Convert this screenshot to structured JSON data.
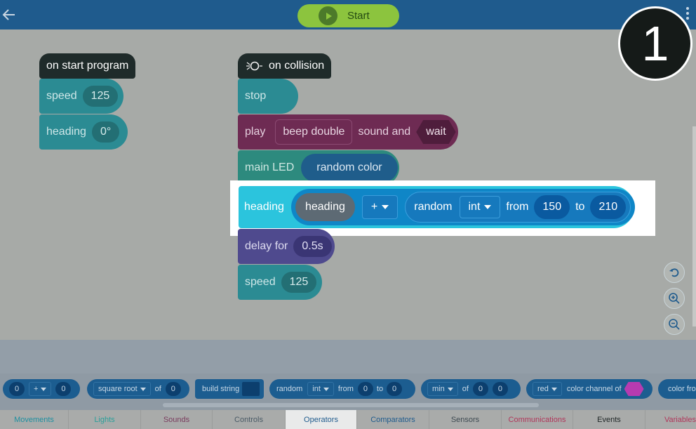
{
  "toolbar": {
    "start_label": "Start"
  },
  "step_badge": "1",
  "blocks": {
    "start_hat": "on start program",
    "speed_label": "speed",
    "speed_value": "125",
    "heading_label": "heading",
    "heading_value": "0°",
    "collision_hat": "on collision",
    "stop": "stop",
    "play": "play",
    "sound_name": "beep double",
    "sound_and": "sound and",
    "wait": "wait",
    "main_led": "main LED",
    "random_color": "random color",
    "heading2": "heading",
    "heading_var": "heading",
    "operator": "+",
    "random": "random",
    "int": "int",
    "from": "from",
    "from_value": "150",
    "to": "to",
    "to_value": "210",
    "delay_for": "delay for",
    "delay_value": "0.5s",
    "speed2": "speed",
    "speed2_value": "125"
  },
  "palette": {
    "p1_a": "0",
    "p1_op": "+",
    "p1_b": "0",
    "p2_fn": "square root",
    "p2_of": "of",
    "p2_v": "0",
    "p3": "build string",
    "p4_random": "random",
    "p4_int": "int",
    "p4_from": "from",
    "p4_a": "0",
    "p4_to": "to",
    "p4_b": "0",
    "p5_fn": "min",
    "p5_of": "of",
    "p5_a": "0",
    "p5_b": "0",
    "p6_color": "red",
    "p6_text": "color channel of",
    "p7": "color fro"
  },
  "tabs": [
    {
      "label": "Movements",
      "color": "#1f8fa0"
    },
    {
      "label": "Lights",
      "color": "#2a9f9a"
    },
    {
      "label": "Sounds",
      "color": "#7a3c5e"
    },
    {
      "label": "Controls",
      "color": "#4a5a66"
    },
    {
      "label": "Operators",
      "color": "#1f5b8d"
    },
    {
      "label": "Comparators",
      "color": "#1f5b8d"
    },
    {
      "label": "Sensors",
      "color": "#3e4a52"
    },
    {
      "label": "Communications",
      "color": "#b0365a"
    },
    {
      "label": "Events",
      "color": "#1e2526"
    },
    {
      "label": "Variables",
      "color": "#b0365a"
    }
  ],
  "colors": {
    "topbar": "#1f5b8d",
    "start": "#8cc43e",
    "highlight_block": "#2bc4dd"
  }
}
